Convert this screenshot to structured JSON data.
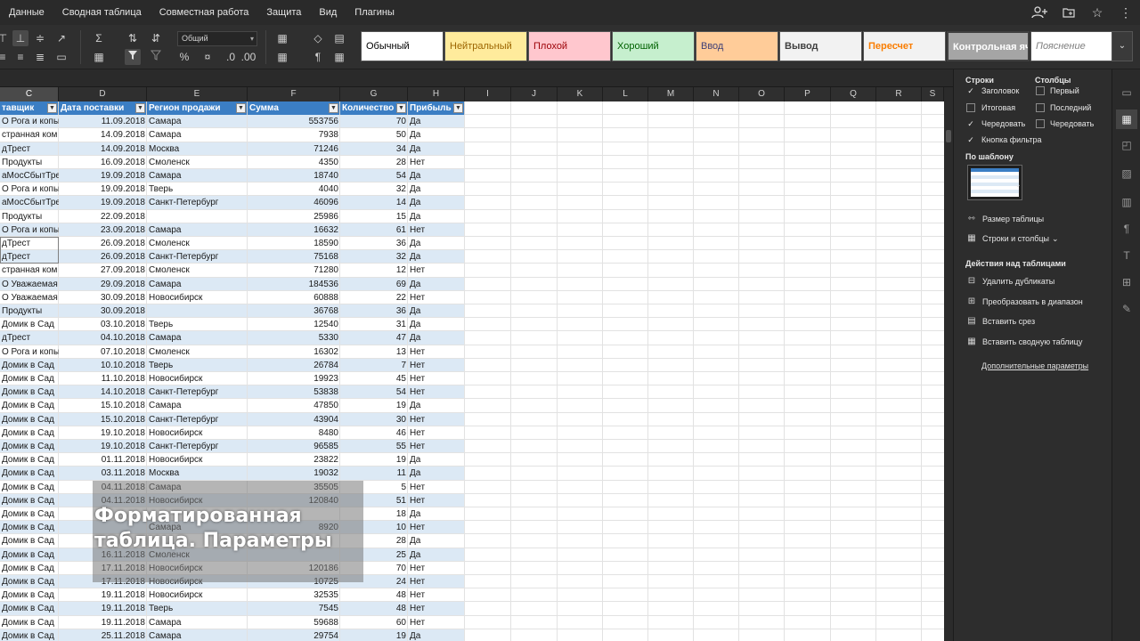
{
  "menu": {
    "items": [
      "Данные",
      "Сводная таблица",
      "Совместная работа",
      "Защита",
      "Вид",
      "Плагины"
    ],
    "right_icons": [
      "add-user-icon",
      "folder-icon",
      "star-icon",
      "more-icon"
    ]
  },
  "toolbar": {
    "number_format": "Общий",
    "cell_styles": [
      {
        "label": "Обычный",
        "bg": "#ffffff",
        "fg": "#000000"
      },
      {
        "label": "Нейтральный",
        "bg": "#ffeb9c",
        "fg": "#9c6500"
      },
      {
        "label": "Плохой",
        "bg": "#ffc7ce",
        "fg": "#9c0006"
      },
      {
        "label": "Хороший",
        "bg": "#c6efce",
        "fg": "#006100"
      },
      {
        "label": "Ввод",
        "bg": "#ffcc99",
        "fg": "#3f3f76"
      },
      {
        "label": "Вывод",
        "bg": "#f2f2f2",
        "fg": "#3f3f3f"
      },
      {
        "label": "Пересчет",
        "bg": "#f2f2f2",
        "fg": "#fa7d00"
      },
      {
        "label": "Контрольная яче",
        "bg": "#a5a5a5",
        "fg": "#ffffff"
      },
      {
        "label": "Пояснение",
        "bg": "#ffffff",
        "fg": "#7f7f7f"
      }
    ]
  },
  "grid": {
    "columns": [
      "C",
      "D",
      "E",
      "F",
      "G",
      "H",
      "I",
      "J",
      "K",
      "L",
      "M",
      "N",
      "O",
      "P",
      "Q",
      "R",
      "S"
    ],
    "table_headers": [
      "тавщик",
      "Дата поставки",
      "Регион продажи",
      "Сумма",
      "Количество",
      "Прибыль"
    ],
    "rows": [
      [
        "О Рога и копы",
        "11.09.2018",
        "Самара",
        "553756",
        "70",
        "Да"
      ],
      [
        "странная ком",
        "14.09.2018",
        "Самара",
        "7938",
        "50",
        "Да"
      ],
      [
        "дТрест",
        "14.09.2018",
        "Москва",
        "71246",
        "34",
        "Да"
      ],
      [
        "Продукты",
        "16.09.2018",
        "Смоленск",
        "4350",
        "28",
        "Нет"
      ],
      [
        "аМосСбытТре",
        "19.09.2018",
        "Самара",
        "18740",
        "54",
        "Да"
      ],
      [
        "О Рога и копы",
        "19.09.2018",
        "Тверь",
        "4040",
        "32",
        "Да"
      ],
      [
        "аМосСбытТре",
        "19.09.2018",
        "Санкт-Петербург",
        "46096",
        "14",
        "Да"
      ],
      [
        "Продукты",
        "22.09.2018",
        "",
        "25986",
        "15",
        "Да"
      ],
      [
        "О Рога и копы",
        "23.09.2018",
        "Самара",
        "16632",
        "61",
        "Нет"
      ],
      [
        "дТрест",
        "26.09.2018",
        "Смоленск",
        "18590",
        "36",
        "Да"
      ],
      [
        "дТрест",
        "26.09.2018",
        "Санкт-Петербург",
        "75168",
        "32",
        "Да"
      ],
      [
        "странная ком",
        "27.09.2018",
        "Смоленск",
        "71280",
        "12",
        "Нет"
      ],
      [
        "О Уважаемая",
        "29.09.2018",
        "Самара",
        "184536",
        "69",
        "Да"
      ],
      [
        "О Уважаемая",
        "30.09.2018",
        "Новосибирск",
        "60888",
        "22",
        "Нет"
      ],
      [
        "Продукты",
        "30.09.2018",
        "",
        "36768",
        "36",
        "Да"
      ],
      [
        "Домик в Сад",
        "03.10.2018",
        "Тверь",
        "12540",
        "31",
        "Да"
      ],
      [
        "дТрест",
        "04.10.2018",
        "Самара",
        "5330",
        "47",
        "Да"
      ],
      [
        "О Рога и копы",
        "07.10.2018",
        "Смоленск",
        "16302",
        "13",
        "Нет"
      ],
      [
        "Домик в Сад",
        "10.10.2018",
        "Тверь",
        "26784",
        "7",
        "Нет"
      ],
      [
        "Домик в Сад",
        "11.10.2018",
        "Новосибирск",
        "19923",
        "45",
        "Нет"
      ],
      [
        "Домик в Сад",
        "14.10.2018",
        "Санкт-Петербург",
        "53838",
        "54",
        "Нет"
      ],
      [
        "Домик в Сад",
        "15.10.2018",
        "Самара",
        "47850",
        "19",
        "Да"
      ],
      [
        "Домик в Сад",
        "15.10.2018",
        "Санкт-Петербург",
        "43904",
        "30",
        "Нет"
      ],
      [
        "Домик в Сад",
        "19.10.2018",
        "Новосибирск",
        "8480",
        "46",
        "Нет"
      ],
      [
        "Домик в Сад",
        "19.10.2018",
        "Санкт-Петербург",
        "96585",
        "55",
        "Нет"
      ],
      [
        "Домик в Сад",
        "01.11.2018",
        "Новосибирск",
        "23822",
        "19",
        "Да"
      ],
      [
        "Домик в Сад",
        "03.11.2018",
        "Москва",
        "19032",
        "11",
        "Да"
      ],
      [
        "Домик в Сад",
        "04.11.2018",
        "Самара",
        "35505",
        "5",
        "Нет"
      ],
      [
        "Домик в Сад",
        "04.11.2018",
        "Новосибирск",
        "120840",
        "51",
        "Нет"
      ],
      [
        "Домик в Сад",
        "",
        "",
        "",
        "18",
        "Да"
      ],
      [
        "Домик в Сад",
        "",
        "Самара",
        "8920",
        "10",
        "Нет"
      ],
      [
        "Домик в Сад",
        "",
        "",
        "",
        "28",
        "Да"
      ],
      [
        "Домик в Сад",
        "16.11.2018",
        "Смоленск",
        "",
        "25",
        "Да"
      ],
      [
        "Домик в Сад",
        "17.11.2018",
        "Новосибирск",
        "120186",
        "70",
        "Нет"
      ],
      [
        "Домик в Сад",
        "17.11.2018",
        "Новосибирск",
        "10725",
        "24",
        "Нет"
      ],
      [
        "Домик в Сад",
        "19.11.2018",
        "Новосибирск",
        "32535",
        "48",
        "Нет"
      ],
      [
        "Домик в Сад",
        "19.11.2018",
        "Тверь",
        "7545",
        "48",
        "Нет"
      ],
      [
        "Домик в Сад",
        "19.11.2018",
        "Самара",
        "59688",
        "60",
        "Нет"
      ],
      [
        "Домик в Сад",
        "25.11.2018",
        "Самара",
        "29754",
        "19",
        "Да"
      ]
    ]
  },
  "overlay": {
    "line1": "Форматированная",
    "line2": "таблица. Параметры"
  },
  "panel": {
    "rows_title": "Строки",
    "cols_title": "Столбцы",
    "rows_options": [
      {
        "label": "Заголовок",
        "checked": true
      },
      {
        "label": "Итоговая",
        "checked": false
      },
      {
        "label": "Чередовать",
        "checked": true
      },
      {
        "label": "Кнопка фильтра",
        "checked": true
      }
    ],
    "cols_options": [
      {
        "label": "Первый",
        "checked": false
      },
      {
        "label": "Последний",
        "checked": false
      },
      {
        "label": "Чередовать",
        "checked": false
      }
    ],
    "template_label": "По шаблону",
    "table_size": "Размер таблицы",
    "rows_and_cols": "Строки и столбцы",
    "actions_title": "Действия над таблицами",
    "actions": [
      "Удалить дубликаты",
      "Преобразовать в диапазон",
      "Вставить срез",
      "Вставить сводную таблицу"
    ],
    "advanced_link": "Дополнительные параметры"
  },
  "colors": {
    "header_blue": "#3b7ec4",
    "band_blue": "#dce9f5",
    "panel_bg": "#2d2d2d"
  }
}
